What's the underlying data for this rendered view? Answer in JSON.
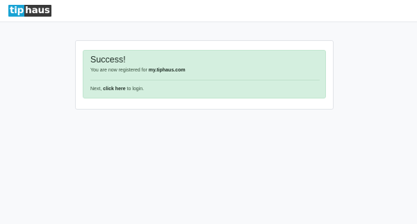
{
  "header": {
    "logo_part1": "tip",
    "logo_part2": "haus"
  },
  "alert": {
    "title": "Success!",
    "registered_prefix": "You are now registered for ",
    "registered_site": "my.tiphaus.com",
    "next_prefix": "Next, ",
    "login_link": "click here",
    "next_suffix": " to login."
  },
  "colors": {
    "background": "#f8f9fb",
    "alert_bg": "#d4efdf",
    "logo_blue": "#1aa3d4",
    "logo_dark": "#3a3a3a"
  }
}
